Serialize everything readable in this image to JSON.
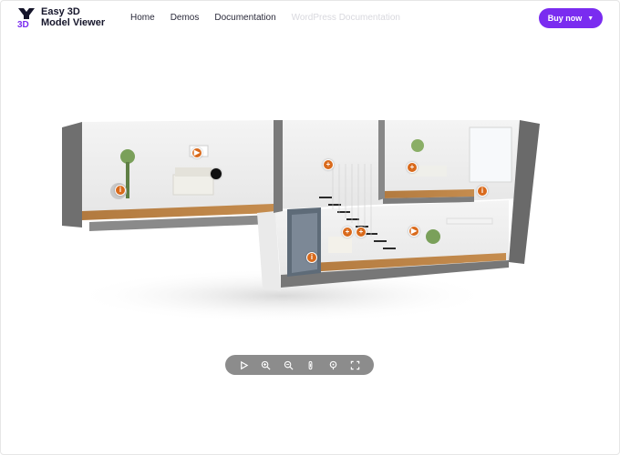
{
  "brand": {
    "line1": "Easy 3D",
    "line2": "Model Viewer",
    "mark_text": "3D",
    "accent": "#7a2cf0"
  },
  "nav": {
    "items": [
      {
        "label": "Home",
        "state": "normal"
      },
      {
        "label": "Demos",
        "state": "normal"
      },
      {
        "label": "Documentation",
        "state": "normal"
      },
      {
        "label": "WordPress Documentation",
        "state": "faded"
      }
    ]
  },
  "header": {
    "buy_label": "Buy now",
    "buy_icon": "chevron-down-icon",
    "buy_color": "#7a2cf0"
  },
  "viewer": {
    "model": "two-storey house cutaway",
    "hotspot_color": "#d96a1c",
    "hotspots": [
      {
        "icon": "play-icon",
        "glyph": "▶"
      },
      {
        "icon": "info-icon",
        "glyph": "i"
      },
      {
        "icon": "plus-icon",
        "glyph": "+"
      },
      {
        "icon": "plus-icon",
        "glyph": "+"
      },
      {
        "icon": "info-icon",
        "glyph": "i"
      },
      {
        "icon": "info-icon",
        "glyph": "i"
      },
      {
        "icon": "plus-icon",
        "glyph": "+"
      },
      {
        "icon": "plus-icon",
        "glyph": "+"
      },
      {
        "icon": "play-icon",
        "glyph": "▶"
      },
      {
        "icon": "dot-icon",
        "glyph": ""
      }
    ]
  },
  "toolbar": {
    "tools": [
      "play-icon",
      "zoom-in-icon",
      "zoom-out-icon",
      "info-icon",
      "hotspot-icon",
      "fullscreen-icon"
    ]
  }
}
